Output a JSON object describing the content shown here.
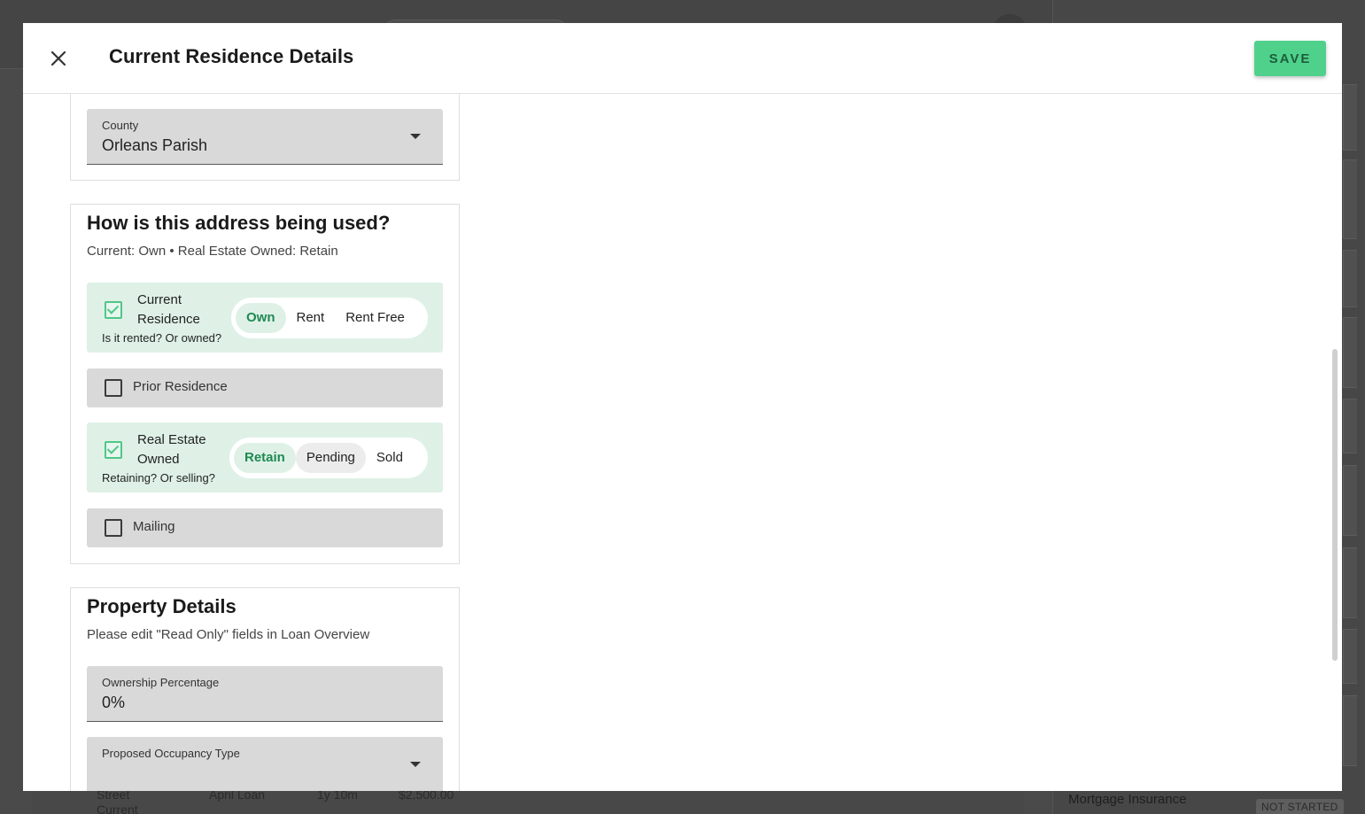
{
  "background": {
    "bottom_row": {
      "street": "Street",
      "current": "Current",
      "loan": "April Loan",
      "term": "1y 10m",
      "amount": "$2,500.00"
    },
    "right_panel": {
      "mortgage_label": "Mortgage Insurance",
      "status_badge": "NOT STARTED"
    }
  },
  "modal": {
    "title": "Current Residence Details",
    "save_label": "SAVE",
    "county": {
      "label": "County",
      "value": "Orleans Parish"
    },
    "usage": {
      "heading": "How is this address being used?",
      "summary": "Current: Own • Real Estate Owned: Retain",
      "current_residence": {
        "title_line1": "Current",
        "title_line2": "Residence",
        "hint": "Is it rented? Or owned?",
        "checked": true,
        "options": [
          "Own",
          "Rent",
          "Rent Free"
        ],
        "selected": "Own"
      },
      "prior_residence": {
        "label": "Prior Residence",
        "checked": false
      },
      "reo": {
        "title_line1": "Real Estate",
        "title_line2": "Owned",
        "hint": "Retaining? Or selling?",
        "checked": true,
        "options": [
          "Retain",
          "Pending",
          "Sold"
        ],
        "selected": "Retain"
      },
      "mailing": {
        "label": "Mailing",
        "checked": false
      }
    },
    "property": {
      "heading": "Property Details",
      "subtitle": "Please edit \"Read Only\" fields in Loan Overview",
      "ownership": {
        "label": "Ownership Percentage",
        "value": "0%"
      },
      "occupancy": {
        "label": "Proposed Occupancy Type",
        "value": ""
      }
    }
  },
  "colors": {
    "accent": "#4fd18c",
    "accent_text": "#1e8a52",
    "active_row_bg": "#dff1e7",
    "field_bg": "#d9d9d9"
  },
  "icons": {
    "close": "close-icon",
    "dropdown": "chevron-down-icon",
    "checkbox": "checkbox-icon"
  }
}
